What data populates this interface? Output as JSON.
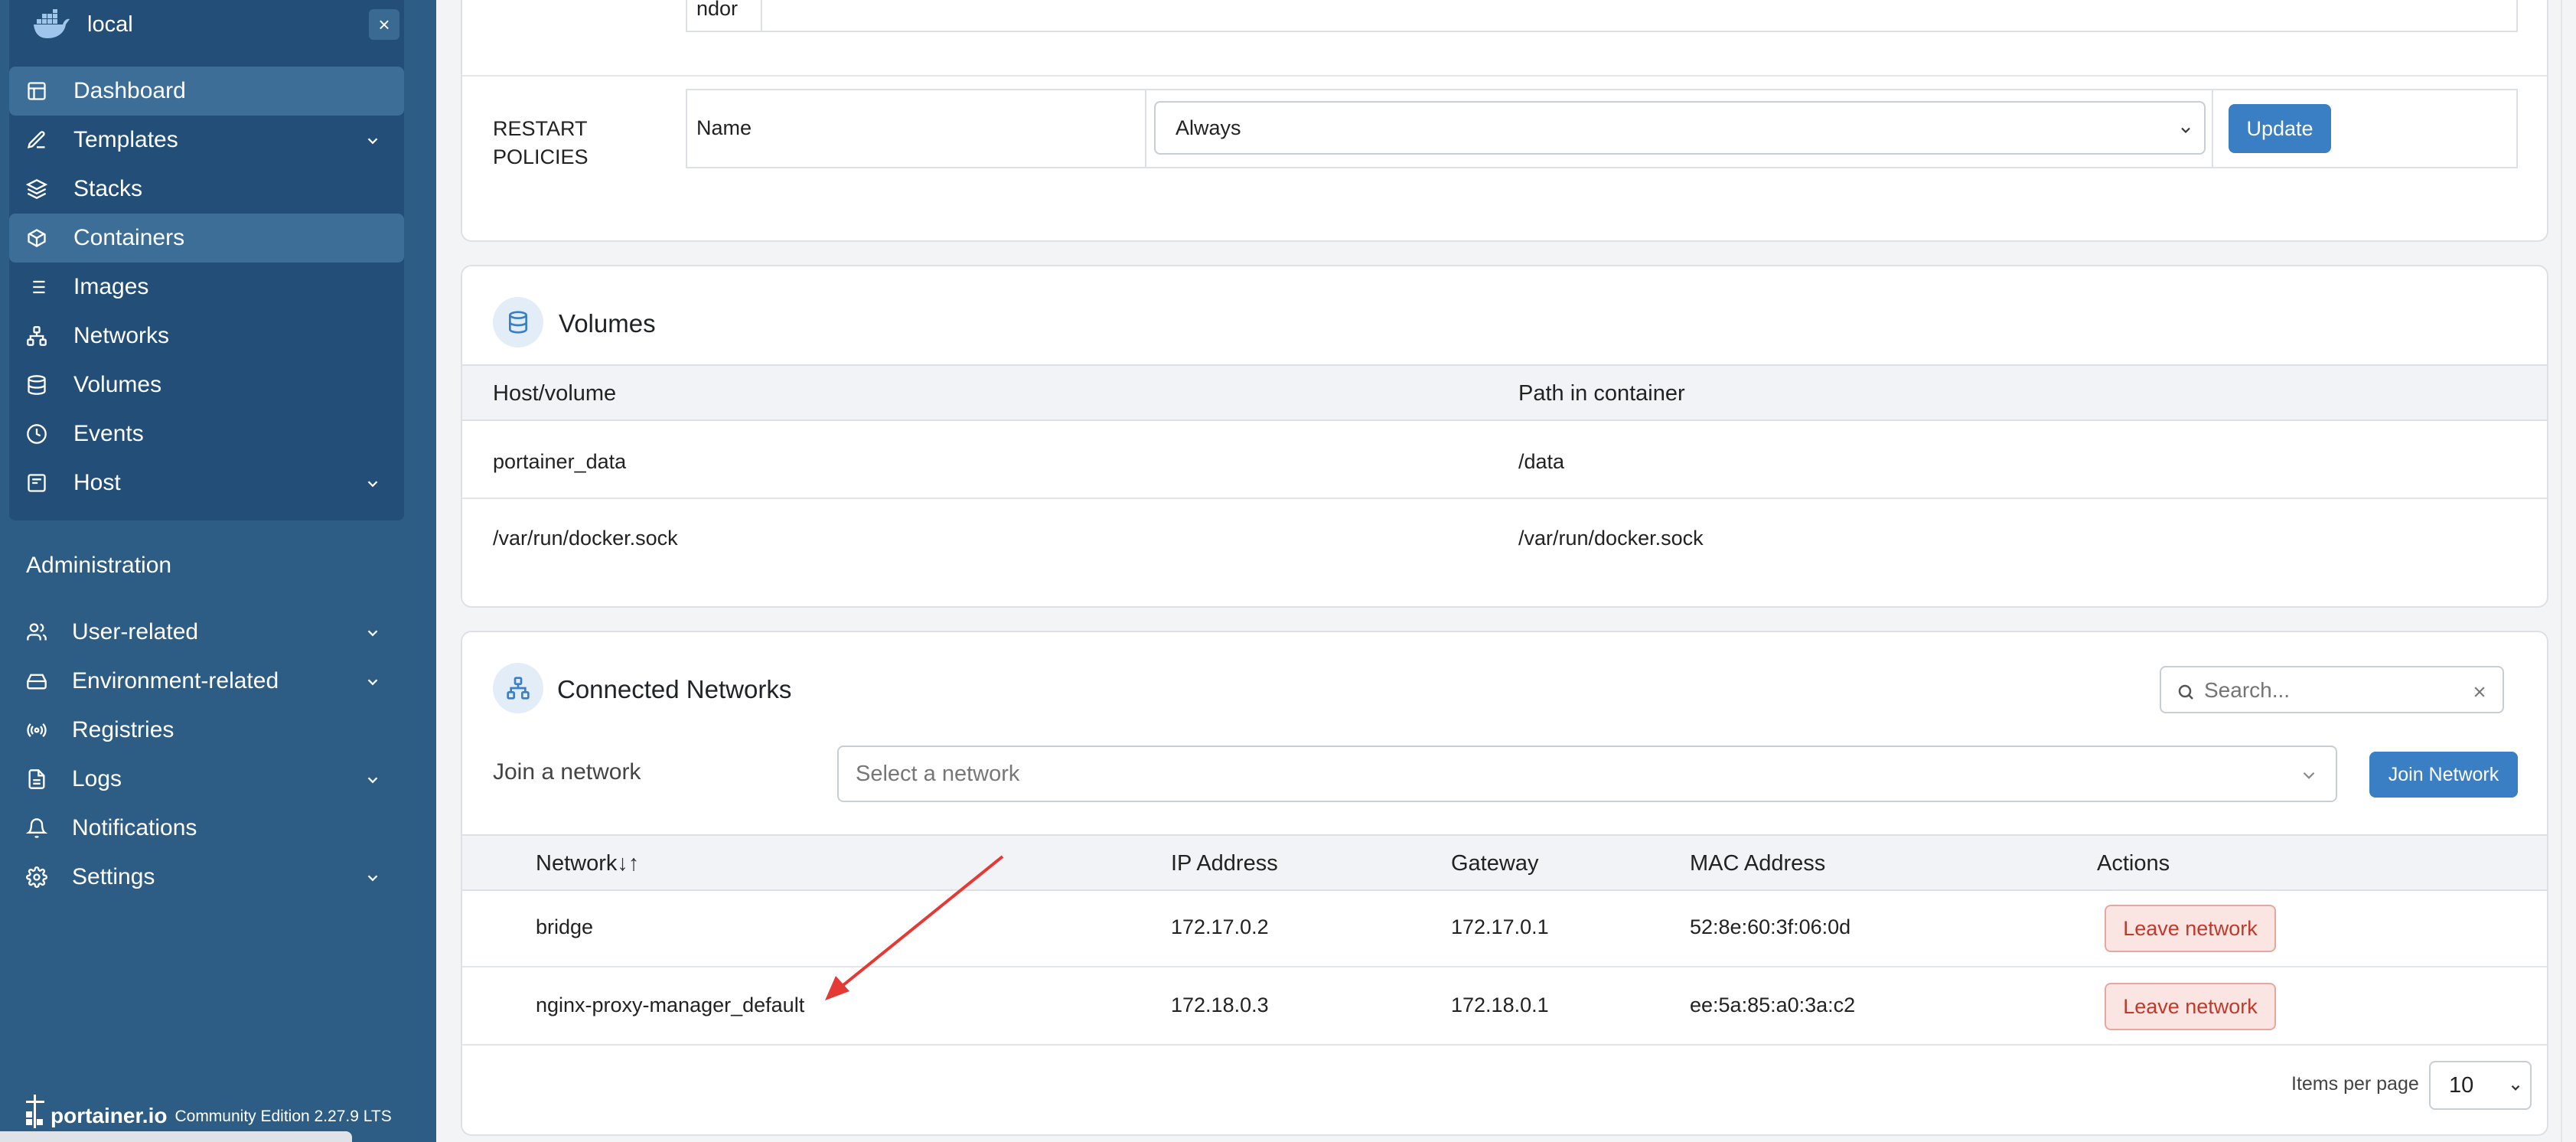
{
  "sidebar": {
    "environment_name": "local",
    "close_label": "×",
    "items": [
      {
        "label": "Dashboard",
        "icon": "dashboard-icon"
      },
      {
        "label": "Templates",
        "icon": "edit-icon"
      },
      {
        "label": "Stacks",
        "icon": "layers-icon"
      },
      {
        "label": "Containers",
        "icon": "box-icon"
      },
      {
        "label": "Images",
        "icon": "list-icon"
      },
      {
        "label": "Networks",
        "icon": "network-icon"
      },
      {
        "label": "Volumes",
        "icon": "database-icon"
      },
      {
        "label": "Events",
        "icon": "clock-icon"
      },
      {
        "label": "Host",
        "icon": "host-icon"
      }
    ],
    "admin_title": "Administration",
    "admin_items": [
      {
        "label": "User-related",
        "icon": "users-icon"
      },
      {
        "label": "Environment-related",
        "icon": "hard-drive-icon"
      },
      {
        "label": "Registries",
        "icon": "radio-icon"
      },
      {
        "label": "Logs",
        "icon": "file-icon"
      },
      {
        "label": "Notifications",
        "icon": "bell-icon"
      },
      {
        "label": "Settings",
        "icon": "gear-icon"
      }
    ],
    "footer": {
      "brand": "portainer.io",
      "edition": "Community Edition 2.27.9 LTS"
    }
  },
  "restart": {
    "top_fragment": "ndor",
    "label": "RESTART POLICIES",
    "name_label": "Name",
    "selected": "Always",
    "update_label": "Update"
  },
  "volumes": {
    "title": "Volumes",
    "columns": [
      "Host/volume",
      "Path in container"
    ],
    "rows": [
      [
        "portainer_data",
        "/data"
      ],
      [
        "/var/run/docker.sock",
        "/var/run/docker.sock"
      ]
    ]
  },
  "networks": {
    "title": "Connected Networks",
    "search_placeholder": "Search...",
    "join_label": "Join a network",
    "select_placeholder": "Select a network",
    "join_button": "Join Network",
    "columns": [
      "Network",
      "IP Address",
      "Gateway",
      "MAC Address",
      "Actions"
    ],
    "sort_indicator": "↓↑",
    "rows": [
      {
        "network": "bridge",
        "ip": "172.17.0.2",
        "gateway": "172.17.0.1",
        "mac": "52:8e:60:3f:06:0d",
        "action": "Leave network"
      },
      {
        "network": "nginx-proxy-manager_default",
        "ip": "172.18.0.3",
        "gateway": "172.18.0.1",
        "mac": "ee:5a:85:a0:3a:c2",
        "action": "Leave network"
      }
    ],
    "items_per_page_label": "Items per page",
    "items_per_page": "10"
  },
  "colors": {
    "sidebar": "#2d5c85",
    "primary": "#3a7fc4",
    "link": "#2a6fb0",
    "danger": "#c0392b",
    "annotation_arrow": "#e53935"
  }
}
